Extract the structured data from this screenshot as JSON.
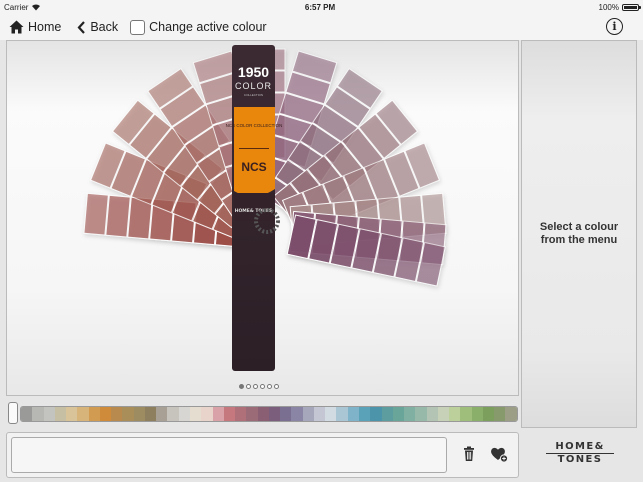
{
  "status": {
    "carrier": "Carrier",
    "time": "6:57 PM",
    "battery": "100%",
    "battery_fraction": 1.0
  },
  "toolbar": {
    "home_label": "Home",
    "back_label": "Back",
    "change_colour_label": "Change active colour",
    "change_colour_checked": false
  },
  "fan": {
    "brand_year": "1950",
    "brand_color": "COLOR",
    "brand_small": "COLLECTION",
    "ncs_label": "NCS COLOR COLLECTION",
    "ncs_logo": "NCS",
    "hat_label": "HOME& TONES"
  },
  "pager": {
    "count": 6,
    "active": 0
  },
  "side_panel": {
    "line1": "Select a colour",
    "line2": "from the menu"
  },
  "colour_strip": {
    "colors": [
      "#9a9a98",
      "#b7b8b3",
      "#c3c3bf",
      "#c6bfa4",
      "#d9c49a",
      "#d6b47a",
      "#d29b52",
      "#cf8a3a",
      "#b88a4d",
      "#a98e5a",
      "#9d8b62",
      "#8e7f5e",
      "#a8a095",
      "#c7c4be",
      "#d8d6d2",
      "#e4ddd0",
      "#e8d4cb",
      "#d9a1a8",
      "#c5797e",
      "#b0707a",
      "#9b6b77",
      "#8a5f73",
      "#7a5e7c",
      "#7a6f90",
      "#8a85a4",
      "#a7a7bc",
      "#c4c7d3",
      "#d3dbe2",
      "#aac6d4",
      "#7fb3c9",
      "#5aa2b8",
      "#4c94a9",
      "#5d9da0",
      "#6aa59a",
      "#7fb0a1",
      "#97b9aa",
      "#b3c4b4",
      "#c6d1b7",
      "#bcd09b",
      "#9fbe7c",
      "#8aaf6b",
      "#7c9f5d",
      "#879a6c",
      "#9c9f86"
    ]
  },
  "logo": {
    "line1": "HOME&",
    "line2": "TONES"
  },
  "icons": {
    "home": "home-icon",
    "back": "chevron-left-icon",
    "info": "info-icon",
    "trash": "trash-icon",
    "heart": "heart-add-icon",
    "wifi": "wifi-icon",
    "battery": "battery-icon"
  }
}
